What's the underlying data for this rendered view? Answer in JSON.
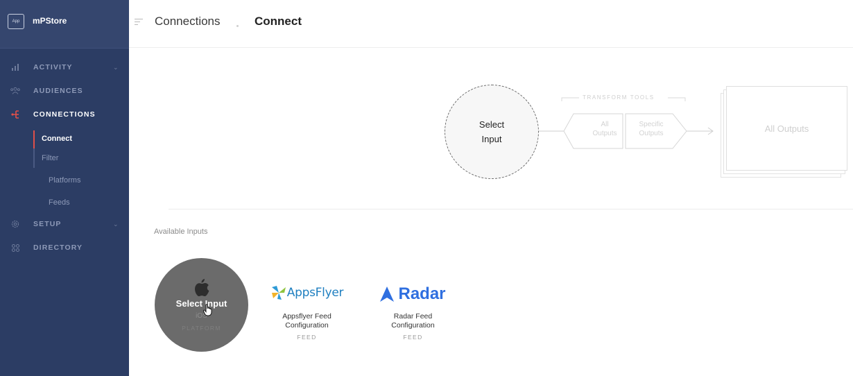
{
  "app": {
    "logo_text": "App",
    "name": "mPStore"
  },
  "sidebar": {
    "items": [
      {
        "label": "ACTIVITY",
        "icon": "bar-chart-icon"
      },
      {
        "label": "AUDIENCES",
        "icon": "people-icon"
      },
      {
        "label": "CONNECTIONS",
        "icon": "connections-icon"
      },
      {
        "label": "SETUP",
        "icon": "gear-icon"
      },
      {
        "label": "DIRECTORY",
        "icon": "grid-icon"
      }
    ],
    "sub_items": [
      "Connect",
      "Filter",
      "Platforms",
      "Feeds"
    ]
  },
  "header": {
    "breadcrumb": "Connections",
    "title": "Connect"
  },
  "flow": {
    "input_line1": "Select",
    "input_line2": "Input",
    "transform_label": "TRANSFORM TOOLS",
    "tool_all_1": "All",
    "tool_all_2": "Outputs",
    "tool_specific_1": "Specific",
    "tool_specific_2": "Outputs",
    "output_label": "All Outputs"
  },
  "available": {
    "label": "Available Inputs",
    "inputs": [
      {
        "hover_label": "Select Input",
        "name": "iOS",
        "type": "PLATFORM",
        "icon": "apple-icon"
      },
      {
        "logo": "AppsFlyer",
        "title_line1": "Appsflyer Feed",
        "title_line2": "Configuration",
        "type": "FEED",
        "icon": "appsflyer-icon"
      },
      {
        "logo": "Radar",
        "title_line1": "Radar Feed",
        "title_line2": "Configuration",
        "type": "FEED",
        "icon": "radar-icon"
      }
    ]
  },
  "colors": {
    "sidebar_bg": "#2c3d64",
    "accent": "#e0504a",
    "radar_blue": "#2f6fe0",
    "appsflyer_blue": "#1f7fc0"
  }
}
